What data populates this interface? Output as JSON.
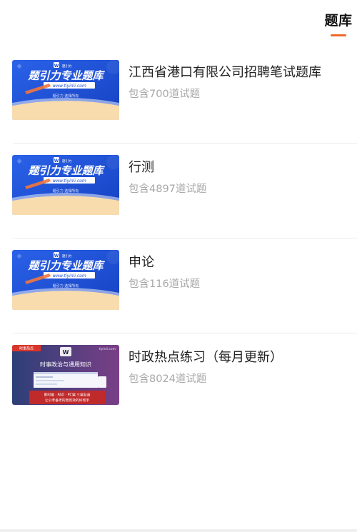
{
  "tab": {
    "label": "题库"
  },
  "colors": {
    "accent": "#ee6a2c",
    "banner_blue": "#1d4fd6",
    "banner_cream": "#f8dcae"
  },
  "banner": {
    "logo_text": "题引力",
    "brand": "题引力专业题库",
    "url": "www.tiyinli.com",
    "slogan": "题引力 选择所有",
    "news_tag": "时事热点",
    "news_site": "tiyinli.com",
    "news_title": "时事政治与通用知识",
    "news_line1": "即时推 · PAD · PC端 三端互通",
    "news_line2": "让公考备考的更高效的好帮手"
  },
  "banks": [
    {
      "title": "江西省港口有限公司招聘笔试题库",
      "count": "包含700道试题",
      "thumb": "brand"
    },
    {
      "title": "行测",
      "count": "包含4897道试题",
      "thumb": "brand"
    },
    {
      "title": "申论",
      "count": "包含116道试题",
      "thumb": "brand"
    },
    {
      "title": "时政热点练习（每月更新）",
      "count": "包含8024道试题",
      "thumb": "news"
    }
  ]
}
